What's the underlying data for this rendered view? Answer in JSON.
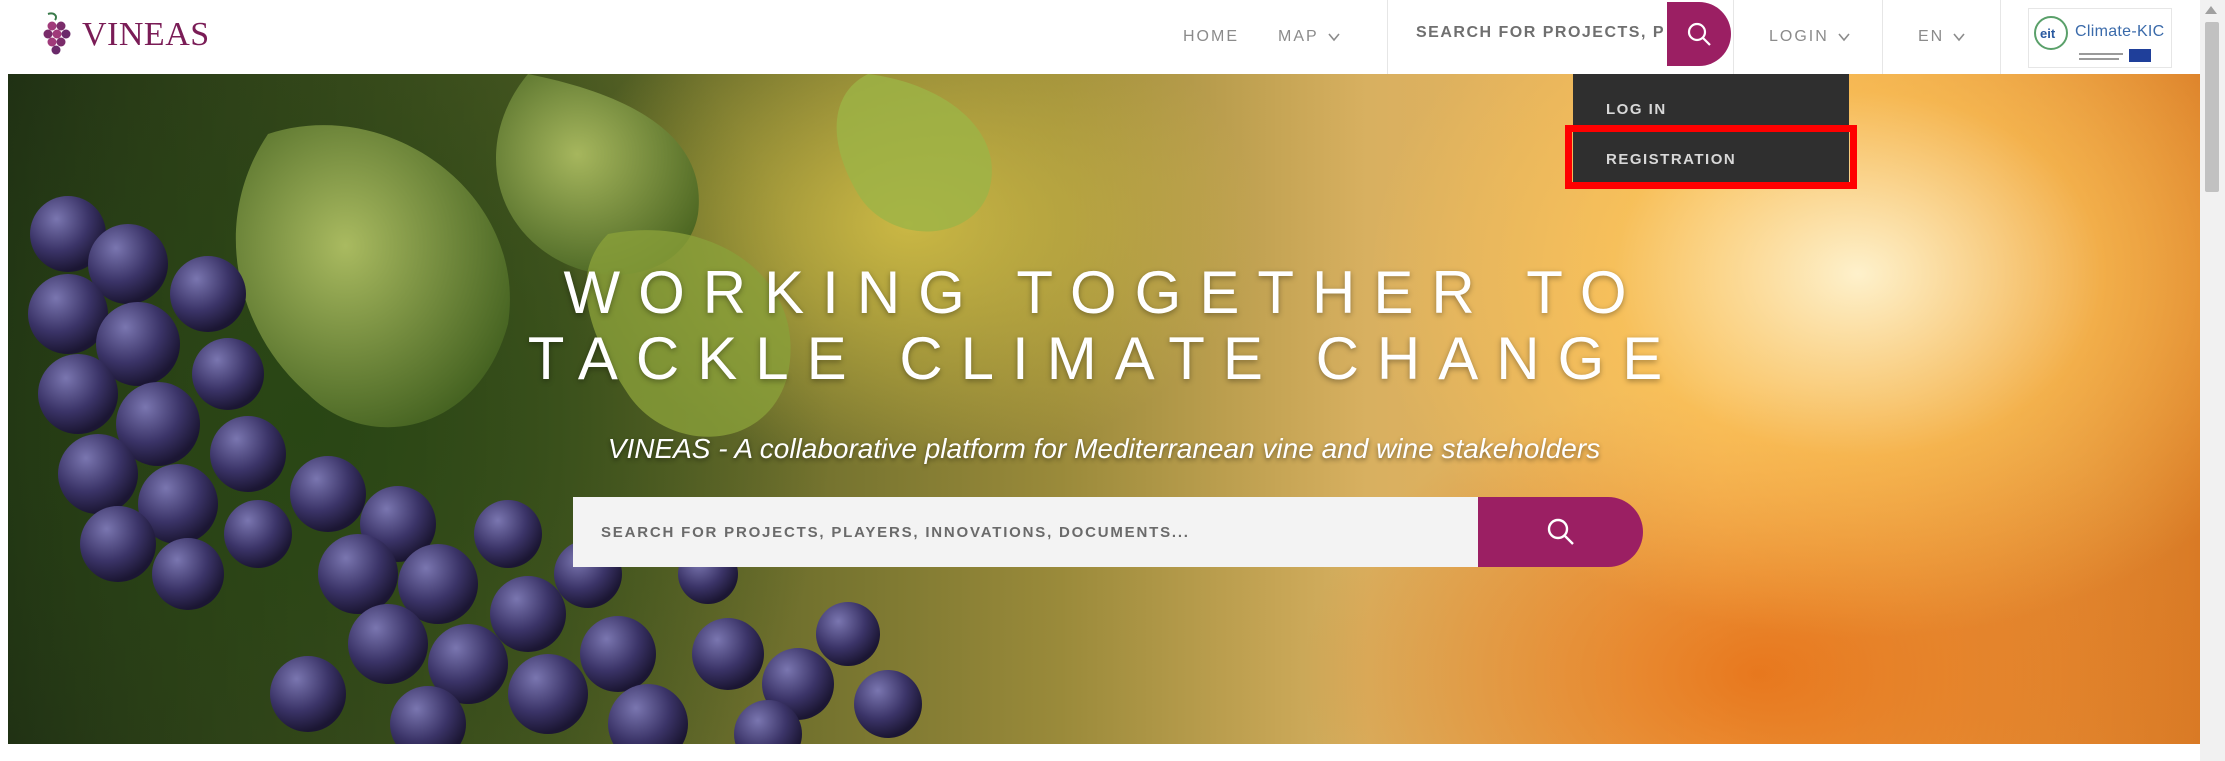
{
  "brand": {
    "name": "VINEAS"
  },
  "nav": {
    "home": "HOME",
    "map": "MAP",
    "search_placeholder": "SEARCH FOR PROJECTS, PL...",
    "login": "LOGIN",
    "lang": "EN",
    "partner_logo": "Climate-KIC"
  },
  "dropdown": {
    "items": [
      "LOG IN",
      "REGISTRATION"
    ]
  },
  "hero": {
    "title_line1": "WORKING TOGETHER TO",
    "title_line2": "TACKLE CLIMATE CHANGE",
    "subtitle": "VINEAS - A collaborative platform for Mediterranean vine and wine stakeholders",
    "search_placeholder": "SEARCH FOR PROJECTS, PLAYERS, INNOVATIONS, DOCUMENTS..."
  },
  "colors": {
    "brand": "#9b1f63",
    "highlight": "#ff0000",
    "dropdown_bg": "#2f2f2f"
  },
  "icons": {
    "search": "search-icon",
    "chevron": "chevron-down-icon",
    "logo": "grape-logo-icon"
  }
}
